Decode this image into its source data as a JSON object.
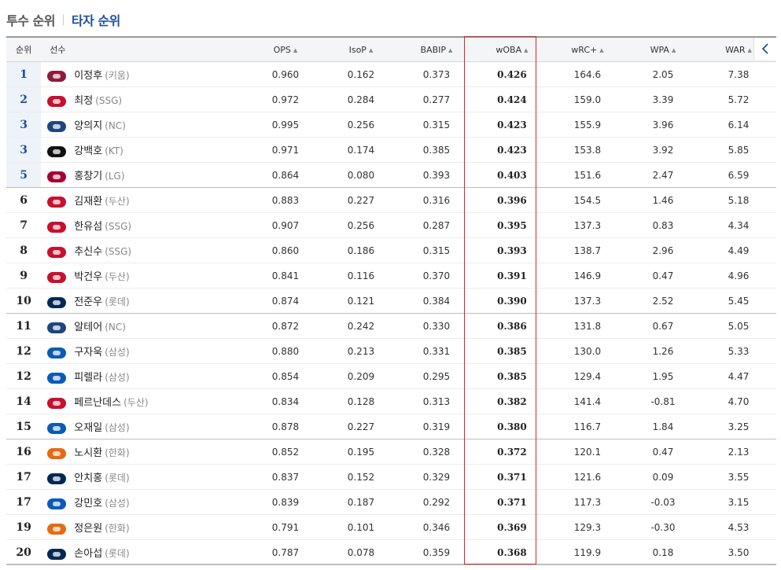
{
  "tabs": [
    {
      "label": "투수 순위",
      "active": false
    },
    {
      "label": "타자 순위",
      "active": true
    }
  ],
  "columns": {
    "rank": "순위",
    "player": "선수",
    "ops": "OPS",
    "isop": "IsoP",
    "babip": "BABIP",
    "woba": "wOBA",
    "wrc": "wRC+",
    "wpa": "WPA",
    "war": "WAR"
  },
  "nav": {
    "icon": "chevron-left-icon"
  },
  "highlight_color": "#d9232b",
  "team_colors": {
    "키움": "#8e1b3a",
    "SSG": "#c8102e",
    "NC": "#1d467f",
    "KT": "#111111",
    "LG": "#a50034",
    "두산": "#c8102e",
    "롯데": "#002955",
    "삼성": "#0a5bb6",
    "한화": "#e86a10"
  },
  "rows": [
    {
      "rank": "1",
      "name": "이정후",
      "team": "(키움)",
      "ops": "0.960",
      "isop": "0.162",
      "babip": "0.373",
      "woba": "0.426",
      "wrc": "164.6",
      "wpa": "2.05",
      "war": "7.38"
    },
    {
      "rank": "2",
      "name": "최정",
      "team": "(SSG)",
      "ops": "0.972",
      "isop": "0.284",
      "babip": "0.277",
      "woba": "0.424",
      "wrc": "159.0",
      "wpa": "3.39",
      "war": "5.72"
    },
    {
      "rank": "3",
      "name": "양의지",
      "team": "(NC)",
      "ops": "0.995",
      "isop": "0.256",
      "babip": "0.315",
      "woba": "0.423",
      "wrc": "155.9",
      "wpa": "3.96",
      "war": "6.14"
    },
    {
      "rank": "3",
      "name": "강백호",
      "team": "(KT)",
      "ops": "0.971",
      "isop": "0.174",
      "babip": "0.385",
      "woba": "0.423",
      "wrc": "153.8",
      "wpa": "3.92",
      "war": "5.85"
    },
    {
      "rank": "5",
      "name": "홍창기",
      "team": "(LG)",
      "ops": "0.864",
      "isop": "0.080",
      "babip": "0.393",
      "woba": "0.403",
      "wrc": "151.6",
      "wpa": "2.47",
      "war": "6.59"
    },
    {
      "rank": "6",
      "name": "김재환",
      "team": "(두산)",
      "ops": "0.883",
      "isop": "0.227",
      "babip": "0.316",
      "woba": "0.396",
      "wrc": "154.5",
      "wpa": "1.46",
      "war": "5.18"
    },
    {
      "rank": "7",
      "name": "한유섬",
      "team": "(SSG)",
      "ops": "0.907",
      "isop": "0.256",
      "babip": "0.287",
      "woba": "0.395",
      "wrc": "137.3",
      "wpa": "0.83",
      "war": "4.34"
    },
    {
      "rank": "8",
      "name": "추신수",
      "team": "(SSG)",
      "ops": "0.860",
      "isop": "0.186",
      "babip": "0.315",
      "woba": "0.393",
      "wrc": "138.7",
      "wpa": "2.96",
      "war": "4.49"
    },
    {
      "rank": "9",
      "name": "박건우",
      "team": "(두산)",
      "ops": "0.841",
      "isop": "0.116",
      "babip": "0.370",
      "woba": "0.391",
      "wrc": "146.9",
      "wpa": "0.47",
      "war": "4.96"
    },
    {
      "rank": "10",
      "name": "전준우",
      "team": "(롯데)",
      "ops": "0.874",
      "isop": "0.121",
      "babip": "0.384",
      "woba": "0.390",
      "wrc": "137.3",
      "wpa": "2.52",
      "war": "5.45"
    },
    {
      "rank": "11",
      "name": "알테어",
      "team": "(NC)",
      "ops": "0.872",
      "isop": "0.242",
      "babip": "0.330",
      "woba": "0.386",
      "wrc": "131.8",
      "wpa": "0.67",
      "war": "5.05"
    },
    {
      "rank": "12",
      "name": "구자욱",
      "team": "(삼성)",
      "ops": "0.880",
      "isop": "0.213",
      "babip": "0.331",
      "woba": "0.385",
      "wrc": "130.0",
      "wpa": "1.26",
      "war": "5.33"
    },
    {
      "rank": "12",
      "name": "피렐라",
      "team": "(삼성)",
      "ops": "0.854",
      "isop": "0.209",
      "babip": "0.295",
      "woba": "0.385",
      "wrc": "129.4",
      "wpa": "1.95",
      "war": "4.47"
    },
    {
      "rank": "14",
      "name": "페르난데스",
      "team": "(두산)",
      "ops": "0.834",
      "isop": "0.128",
      "babip": "0.313",
      "woba": "0.382",
      "wrc": "141.4",
      "wpa": "-0.81",
      "war": "4.70"
    },
    {
      "rank": "15",
      "name": "오재일",
      "team": "(삼성)",
      "ops": "0.878",
      "isop": "0.227",
      "babip": "0.319",
      "woba": "0.380",
      "wrc": "116.7",
      "wpa": "1.84",
      "war": "3.25"
    },
    {
      "rank": "16",
      "name": "노시환",
      "team": "(한화)",
      "ops": "0.852",
      "isop": "0.195",
      "babip": "0.328",
      "woba": "0.372",
      "wrc": "120.1",
      "wpa": "0.47",
      "war": "2.13"
    },
    {
      "rank": "17",
      "name": "안치홍",
      "team": "(롯데)",
      "ops": "0.837",
      "isop": "0.152",
      "babip": "0.329",
      "woba": "0.371",
      "wrc": "121.6",
      "wpa": "0.09",
      "war": "3.55"
    },
    {
      "rank": "17",
      "name": "강민호",
      "team": "(삼성)",
      "ops": "0.839",
      "isop": "0.187",
      "babip": "0.292",
      "woba": "0.371",
      "wrc": "117.3",
      "wpa": "-0.03",
      "war": "3.15"
    },
    {
      "rank": "19",
      "name": "정은원",
      "team": "(한화)",
      "ops": "0.791",
      "isop": "0.101",
      "babip": "0.346",
      "woba": "0.369",
      "wrc": "129.3",
      "wpa": "-0.30",
      "war": "4.53"
    },
    {
      "rank": "20",
      "name": "손아섭",
      "team": "(롯데)",
      "ops": "0.787",
      "isop": "0.078",
      "babip": "0.359",
      "woba": "0.368",
      "wrc": "119.9",
      "wpa": "0.18",
      "war": "3.50"
    }
  ]
}
